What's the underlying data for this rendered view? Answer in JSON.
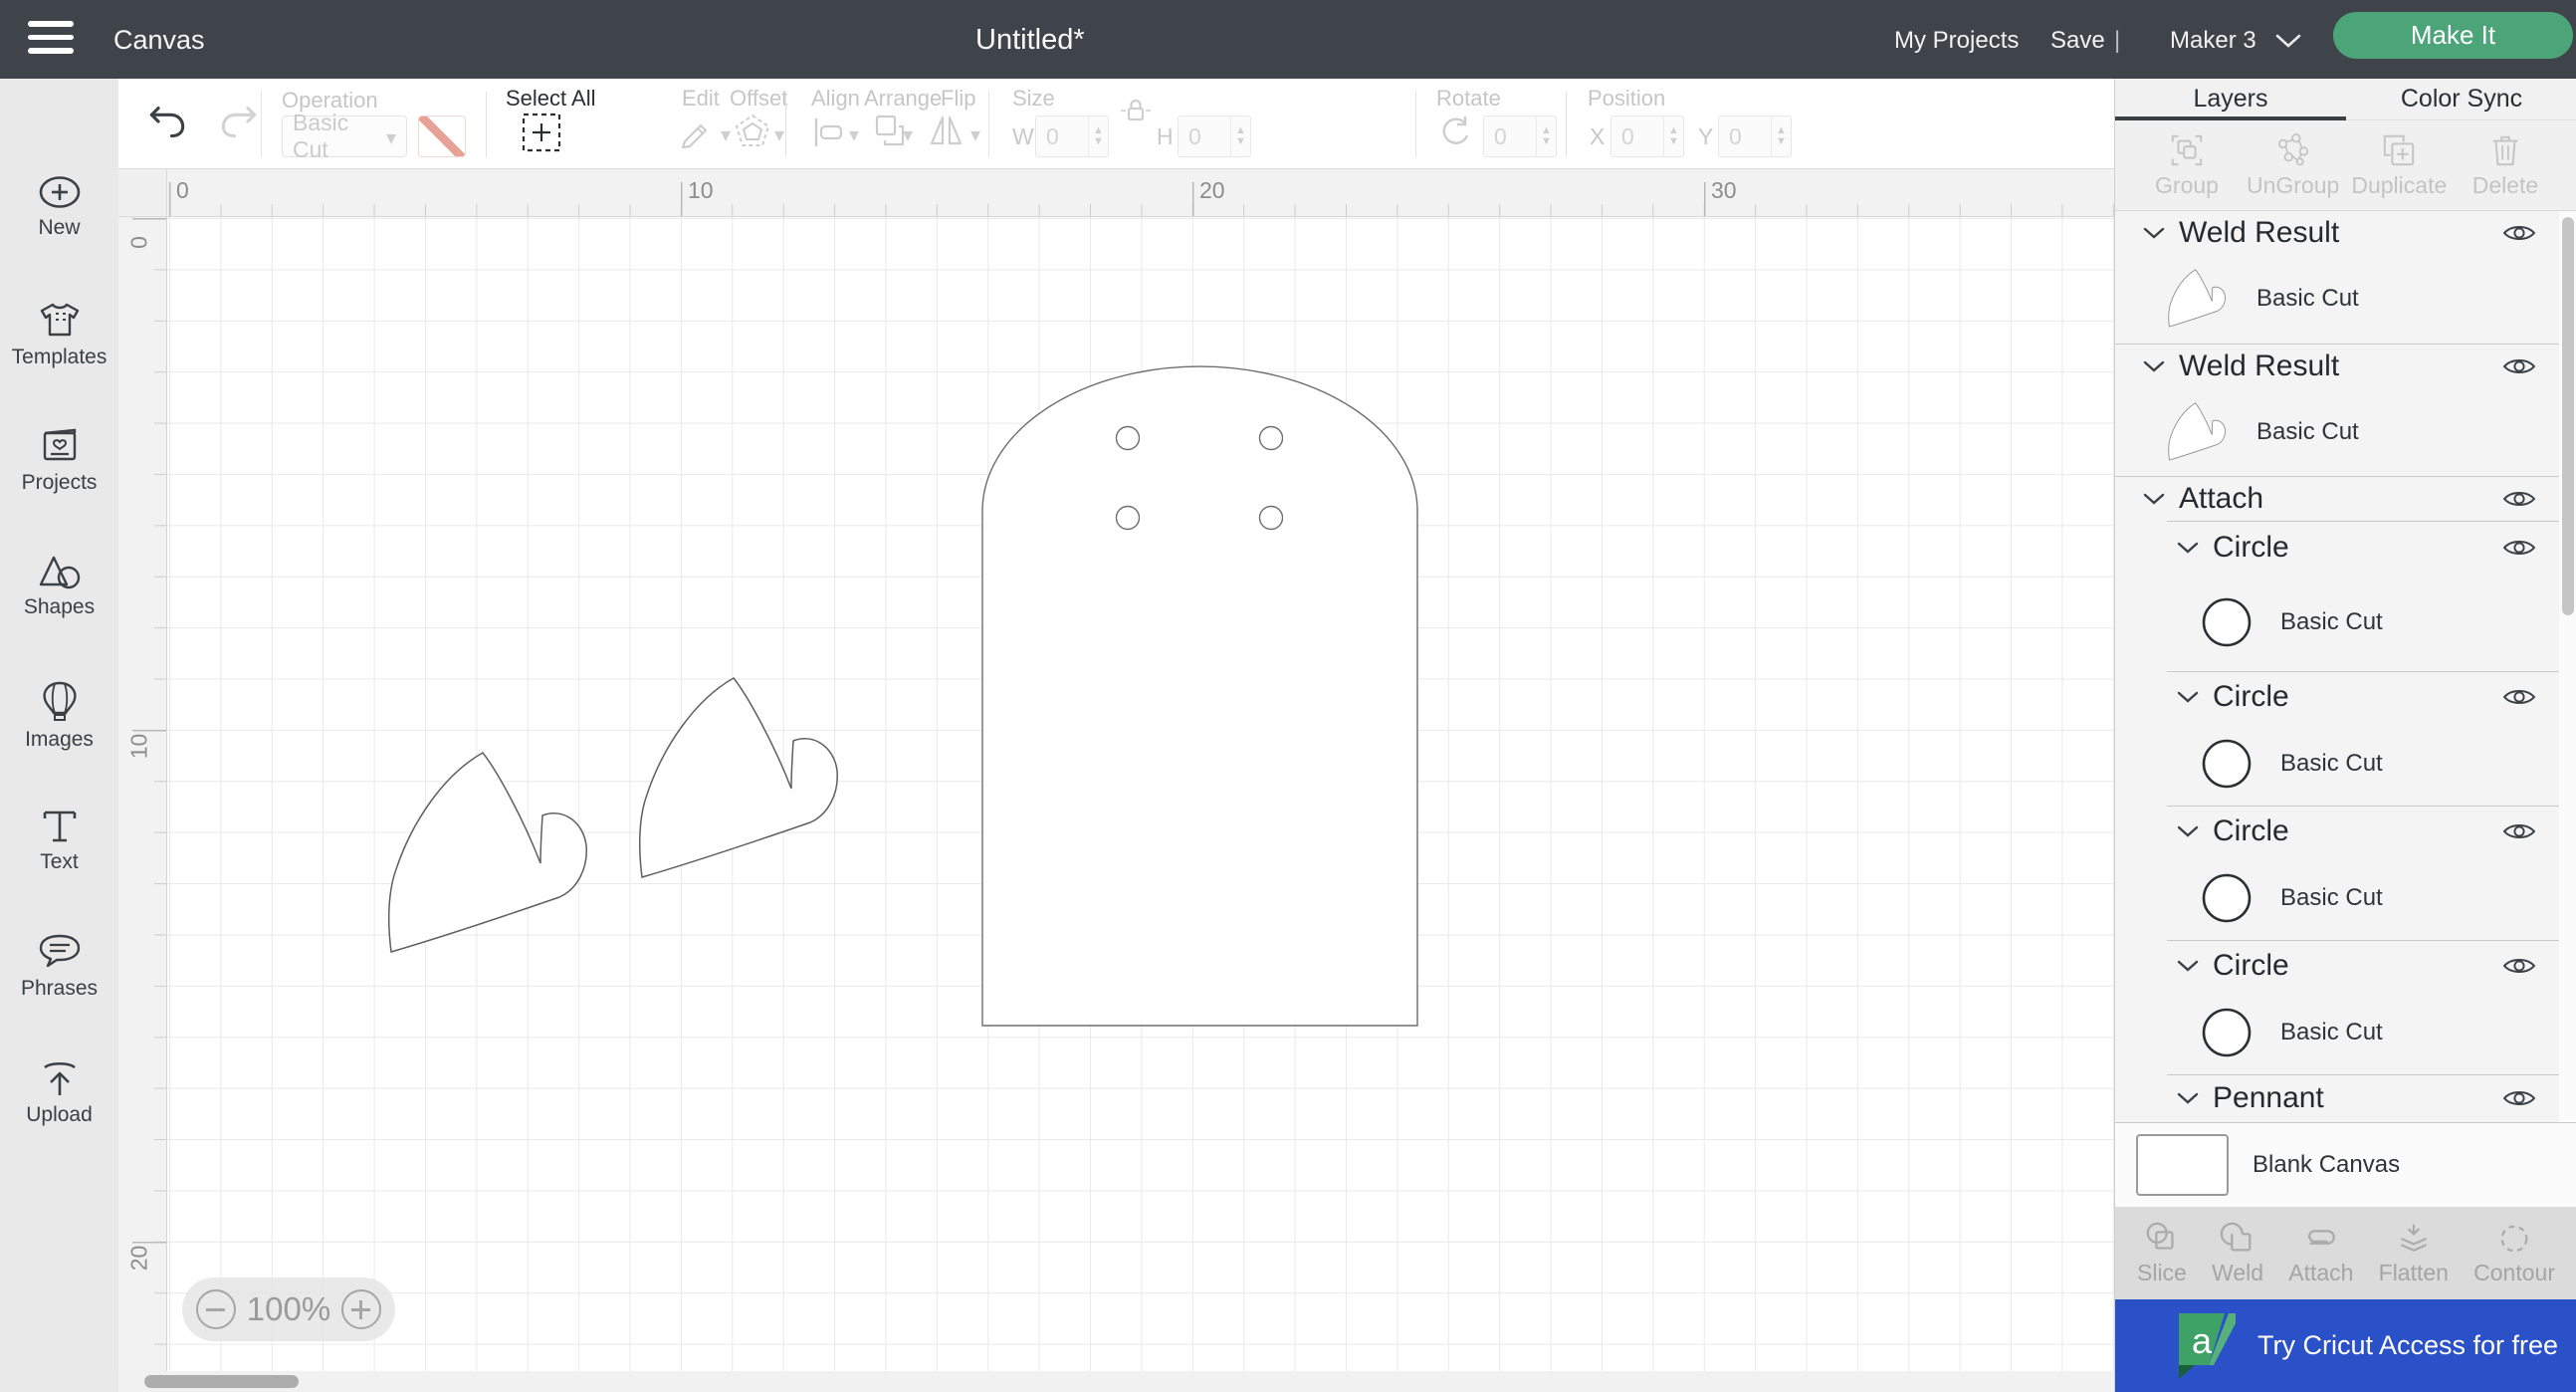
{
  "header": {
    "menu_label": "Canvas",
    "document_title": "Untitled*",
    "my_projects": "My Projects",
    "save": "Save",
    "divider": "|",
    "machine_name": "Maker 3",
    "make_it": "Make It"
  },
  "sidebar": {
    "items": [
      {
        "label": "New"
      },
      {
        "label": "Templates"
      },
      {
        "label": "Projects"
      },
      {
        "label": "Shapes"
      },
      {
        "label": "Images"
      },
      {
        "label": "Text"
      },
      {
        "label": "Phrases"
      },
      {
        "label": "Upload"
      }
    ]
  },
  "toolbar": {
    "operation_label": "Operation",
    "operation_value": "Basic Cut",
    "select_all": "Select All",
    "edit": "Edit",
    "offset": "Offset",
    "align": "Align",
    "arrange": "Arrange",
    "flip": "Flip",
    "size_label": "Size",
    "w_label": "W",
    "w_value": "0",
    "h_label": "H",
    "h_value": "0",
    "rotate_label": "Rotate",
    "rotate_value": "0",
    "position_label": "Position",
    "x_label": "X",
    "x_value": "0",
    "y_label": "Y",
    "y_value": "0"
  },
  "rulers": {
    "top": [
      "0",
      "10",
      "20",
      "30"
    ],
    "left": [
      "0",
      "10",
      "20"
    ]
  },
  "zoom_control": {
    "level": "100%"
  },
  "layers_panel": {
    "tabs": {
      "layers": "Layers",
      "color_sync": "Color Sync"
    },
    "actions": [
      {
        "label": "Group"
      },
      {
        "label": "UnGroup"
      },
      {
        "label": "Duplicate"
      },
      {
        "label": "Delete"
      }
    ],
    "items": [
      {
        "name": "Weld Result",
        "child_label": "Basic Cut"
      },
      {
        "name": "Weld Result",
        "child_label": "Basic Cut"
      },
      {
        "name": "Attach"
      },
      {
        "name": "Circle",
        "child_label": "Basic Cut"
      },
      {
        "name": "Circle",
        "child_label": "Basic Cut"
      },
      {
        "name": "Circle",
        "child_label": "Basic Cut"
      },
      {
        "name": "Circle",
        "child_label": "Basic Cut"
      },
      {
        "name": "Pennant"
      }
    ],
    "blank_canvas_label": "Blank Canvas",
    "bottom_actions": [
      {
        "label": "Slice"
      },
      {
        "label": "Weld"
      },
      {
        "label": "Attach"
      },
      {
        "label": "Flatten"
      },
      {
        "label": "Contour"
      }
    ],
    "banner": {
      "text": "Try Cricut Access for free",
      "logo_letter": "a"
    }
  },
  "colors": {
    "header_bg": "#3F444A",
    "accent_green": "#4CA579",
    "banner_blue": "#2B51C9",
    "swatch_line": "#E8A195"
  }
}
